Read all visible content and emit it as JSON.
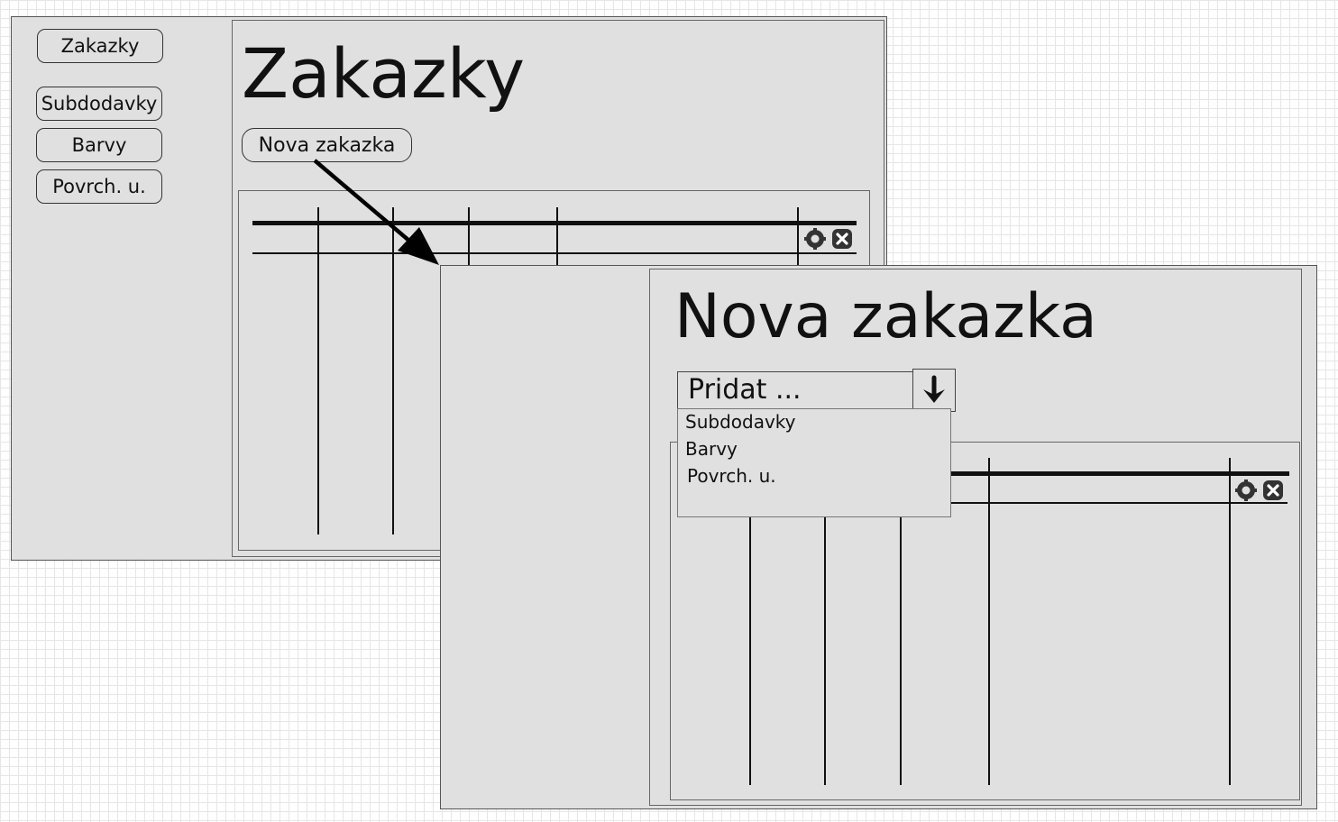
{
  "screen1": {
    "nav": {
      "items": [
        {
          "label": "Zakazky"
        },
        {
          "label": "Subdodavky"
        },
        {
          "label": "Barvy"
        },
        {
          "label": "Povrch. u."
        }
      ]
    },
    "title": "Zakazky",
    "new_button_label": "Nova zakazka",
    "table_icons": [
      "gear-icon",
      "close-icon"
    ]
  },
  "screen2": {
    "title": "Nova zakazka",
    "dropdown": {
      "selected": "Pridat ...",
      "options": [
        "Subdodavky",
        "Barvy",
        "Povrch. u."
      ]
    },
    "table_icons": [
      "gear-icon",
      "close-icon"
    ]
  }
}
